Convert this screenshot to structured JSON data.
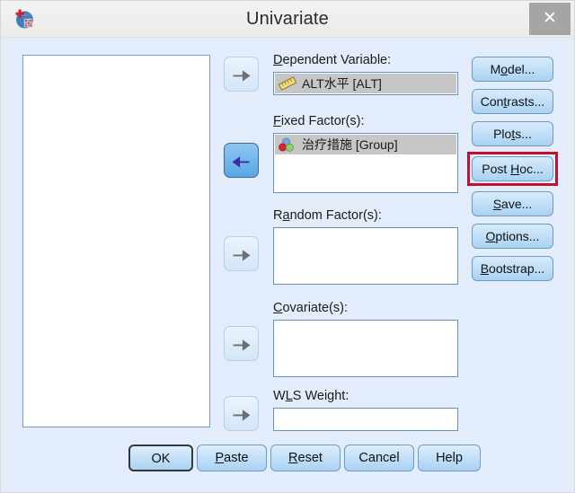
{
  "window": {
    "title": "Univariate",
    "app_icon": "spss-icon",
    "close_label": "✕"
  },
  "colors": {
    "dialog_background": "#e3ecfb",
    "titlebar_background": "#f0eeee",
    "button_blue": "#a9d2f2",
    "highlight_red": "#c2102e",
    "selected_row": "#c6c6c6",
    "field_border": "#6a90b8"
  },
  "source_list": {
    "name": "source-variable-list",
    "items": []
  },
  "arrows": [
    {
      "name": "move-to-dependent-variable",
      "direction": "right",
      "active": false
    },
    {
      "name": "move-to-fixed-factors",
      "direction": "left",
      "active": true
    },
    {
      "name": "move-to-random-factors",
      "direction": "right",
      "active": false
    },
    {
      "name": "move-to-covariates",
      "direction": "right",
      "active": false
    },
    {
      "name": "move-to-wls-weight",
      "direction": "right",
      "active": false
    }
  ],
  "fields": [
    {
      "key": "dependent_variable",
      "label_prefix": "",
      "label_mnemonic": "D",
      "label_suffix": "ependent Variable:",
      "full_label": "Dependent Variable:",
      "items": [
        {
          "icon": "scale-ruler-icon",
          "text": "ALT水平 [ALT]",
          "selected": true
        }
      ]
    },
    {
      "key": "fixed_factors",
      "label_prefix": "",
      "label_mnemonic": "F",
      "label_suffix": "ixed Factor(s):",
      "full_label": "Fixed Factor(s):",
      "items": [
        {
          "icon": "nominal-circles-icon",
          "text": "治疗措施 [Group]",
          "selected": true
        }
      ]
    },
    {
      "key": "random_factors",
      "label_prefix": "R",
      "label_mnemonic": "a",
      "label_suffix": "ndom Factor(s):",
      "full_label": "Random Factor(s):",
      "items": []
    },
    {
      "key": "covariates",
      "label_prefix": "",
      "label_mnemonic": "C",
      "label_suffix": "ovariate(s):",
      "full_label": "Covariate(s):",
      "items": []
    },
    {
      "key": "wls_weight",
      "label_prefix": "W",
      "label_mnemonic": "L",
      "label_suffix": "S Weight:",
      "full_label": "WLS Weight:",
      "items": []
    }
  ],
  "side_buttons": [
    {
      "name": "model-button",
      "prefix": "M",
      "mnemonic": "o",
      "suffix": "del...",
      "full": "Model...",
      "highlighted": false
    },
    {
      "name": "contrasts-button",
      "prefix": "Con",
      "mnemonic": "t",
      "suffix": "rasts...",
      "full": "Contrasts...",
      "highlighted": false
    },
    {
      "name": "plots-button",
      "prefix": "Plo",
      "mnemonic": "t",
      "suffix": "s...",
      "full": "Plots...",
      "highlighted": false
    },
    {
      "name": "post-hoc-button",
      "prefix": "Post ",
      "mnemonic": "H",
      "suffix": "oc...",
      "full": "Post Hoc...",
      "highlighted": true
    },
    {
      "name": "save-button",
      "prefix": "",
      "mnemonic": "S",
      "suffix": "ave...",
      "full": "Save...",
      "highlighted": false
    },
    {
      "name": "options-button",
      "prefix": "",
      "mnemonic": "O",
      "suffix": "ptions...",
      "full": "Options...",
      "highlighted": false
    },
    {
      "name": "bootstrap-button",
      "prefix": "",
      "mnemonic": "B",
      "suffix": "ootstrap...",
      "full": "Bootstrap...",
      "highlighted": false
    }
  ],
  "bottom_buttons": [
    {
      "name": "ok-button",
      "prefix": "",
      "mnemonic": "",
      "suffix": "OK",
      "full": "OK",
      "focused": true
    },
    {
      "name": "paste-button",
      "prefix": "",
      "mnemonic": "P",
      "suffix": "aste",
      "full": "Paste",
      "focused": false
    },
    {
      "name": "reset-button",
      "prefix": "",
      "mnemonic": "R",
      "suffix": "eset",
      "full": "Reset",
      "focused": false
    },
    {
      "name": "cancel-button",
      "prefix": "",
      "mnemonic": "",
      "suffix": "Cancel",
      "full": "Cancel",
      "focused": false
    },
    {
      "name": "help-button",
      "prefix": "",
      "mnemonic": "",
      "suffix": "Help",
      "full": "Help",
      "focused": false
    }
  ]
}
